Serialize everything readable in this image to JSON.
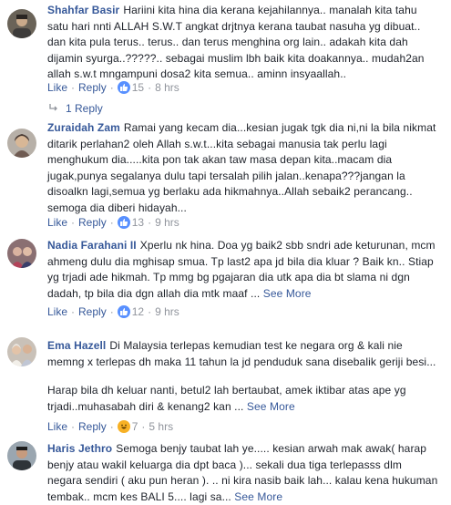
{
  "labels": {
    "like": "Like",
    "reply": "Reply",
    "see_more": "See More",
    "sep": "·"
  },
  "colors": {
    "link": "#365899",
    "meta": "#90949c",
    "text": "#1d2129",
    "like_badge": "#5890ff",
    "haha_badge": "#f7b125"
  },
  "comments": [
    {
      "name": "Shahfar Basir",
      "lines": [
        "Hariini kita hina dia kerana kejahilannya.. manalah kita tahu",
        "satu hari nnti ALLAH S.W.T angkat drjtnya kerana taubat nasuha yg dibuat..",
        "dan kita pula terus.. terus.. dan terus menghina org lain.. adakah kita dah",
        "dijamin syurga..?????.. sebagai muslim lbh baik kita doakannya.. mudah2an",
        "allah s.w.t mngampuni dosa2 kita semua.. aminn insyaallah.."
      ],
      "reaction_icon": "like-icon",
      "reaction_count": "15",
      "time": "8 hrs",
      "replies_label": "1 Reply"
    },
    {
      "name": "Zuraidah Zam",
      "lines": [
        "Ramai yang kecam dia...kesian jugak tgk dia ni,ni la bila nikmat",
        "ditarik perlahan2 oleh Allah s.w.t...kita sebagai manusia tak perlu lagi",
        "menghukum dia.....kita pon tak akan taw masa depan kita..macam dia",
        "jugak,punya segalanya dulu tapi tersalah pilih jalan..kenapa???jangan la",
        "disoalkn lagi,semua yg berlaku ada hikmahnya..Allah sebaik2 perancang..",
        "semoga dia diberi hidayah..."
      ],
      "reaction_icon": "like-icon",
      "reaction_count": "13",
      "time": "9 hrs"
    },
    {
      "name": "Nadia Farahani II",
      "lines": [
        "Xperlu nk hina. Doa yg baik2 sbb sndri ade keturunan, mcm",
        "ahmeng dulu dia mghisap smua. Tp last2 apa jd bila dia kluar ? Baik kn.. Stiap",
        "yg trjadi ade hikmah. Tp mmg bg pgajaran dia utk apa dia bt slama ni dgn",
        "dadah, tp bila dia dgn allah dia mtk maaf ..."
      ],
      "reaction_icon": "like-icon",
      "reaction_count": "12",
      "time": "9 hrs"
    },
    {
      "name": "Ema Hazell",
      "lines": [
        "Di Malaysia terlepas kemudian test ke negara org & kali nie",
        "memng x terlepas dh maka 11 tahun la jd penduduk sana disebalik geriji besi...",
        "",
        "Harap bila dh keluar nanti, betul2 lah bertaubat, amek iktibar atas ape yg",
        "trjadi..muhasabah diri & kenang2 kan ..."
      ],
      "reaction_icon": "haha-icon",
      "reaction_count": "7",
      "time": "5 hrs"
    },
    {
      "name": "Haris Jethro",
      "lines": [
        "Semoga benjy taubat lah ye..... kesian arwah mak awak( harap",
        "benjy atau wakil keluarga dia dpt baca )... sekali dua tiga terlepasss dlm",
        "negara sendiri ( aku pun heran ). .. ni kira nasib baik lah... kalau kena hukuman",
        "tembak.. mcm kes BALI 5.... lagi sa..."
      ]
    }
  ]
}
